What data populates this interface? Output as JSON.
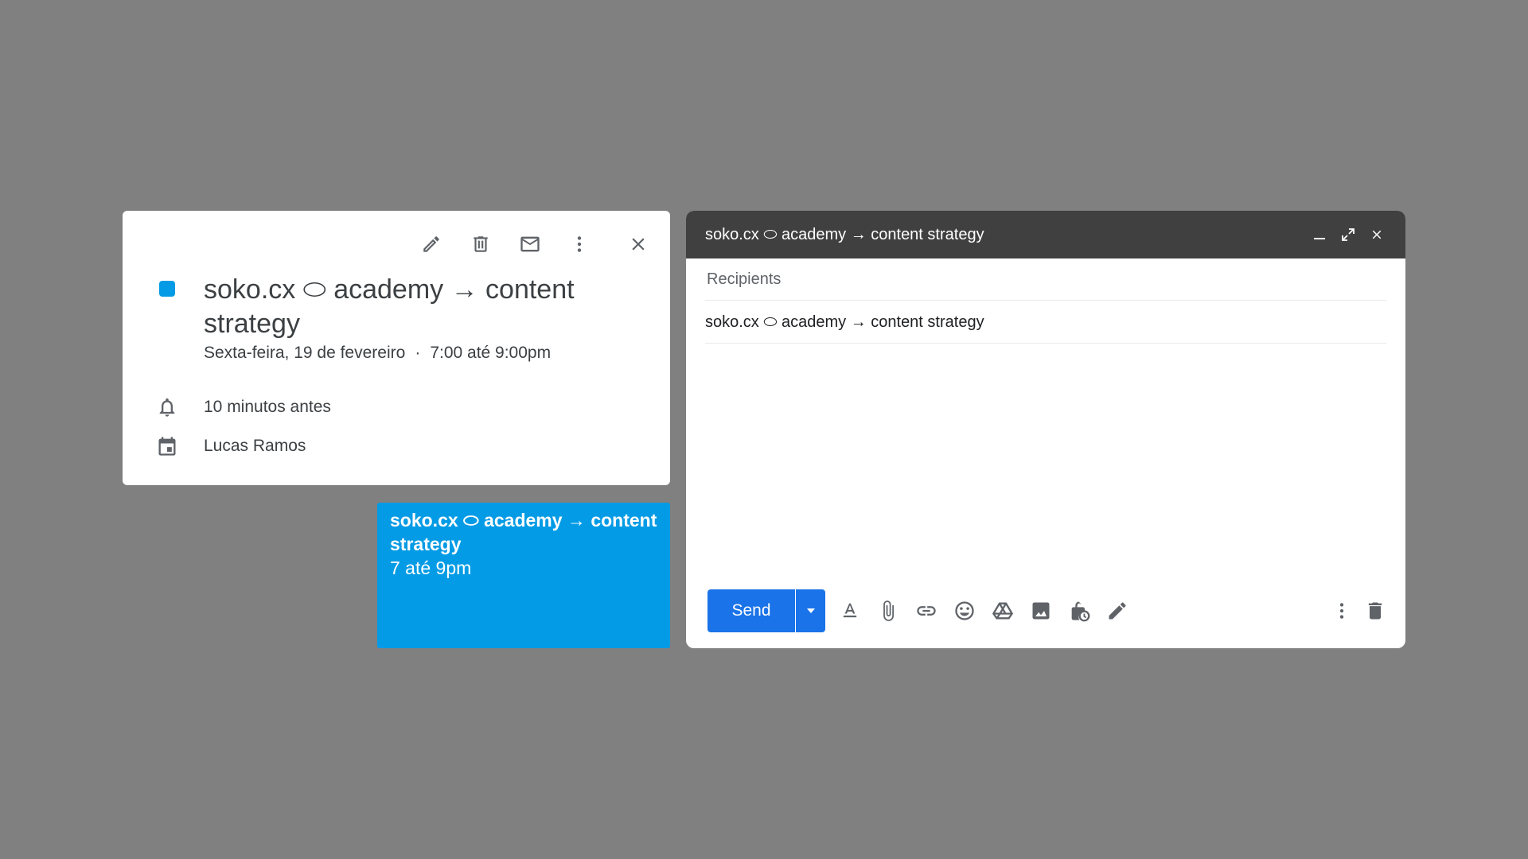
{
  "event_card": {
    "title": "soko.cx ⬭ academy → content strategy",
    "date": "Sexta-feira, 19 de fevereiro",
    "separator": "·",
    "time": "7:00 até 9:00pm",
    "reminder": "10 minutos antes",
    "calendar_owner": "Lucas Ramos",
    "color": "#039be5",
    "toolbar_icons": [
      "edit-icon",
      "delete-icon",
      "email-icon",
      "more-vert-icon",
      "close-icon"
    ]
  },
  "event_chip": {
    "title": "soko.cx ⬭ academy → content strategy",
    "time": "7 até 9pm",
    "color": "#039be5"
  },
  "compose": {
    "title": "soko.cx ⬭ academy → content strategy",
    "recipients_placeholder": "Recipients",
    "subject": "soko.cx ⬭ academy → content strategy",
    "send_label": "Send",
    "header_icons": [
      "minimize-icon",
      "expand-icon",
      "close-icon"
    ],
    "footer_icons": [
      "format-text-icon",
      "attach-icon",
      "link-icon",
      "emoji-icon",
      "drive-icon",
      "photo-icon",
      "confidential-icon",
      "signature-icon",
      "more-vert-icon",
      "discard-icon"
    ],
    "accent": "#1a73e8",
    "header_bg": "#404040"
  }
}
